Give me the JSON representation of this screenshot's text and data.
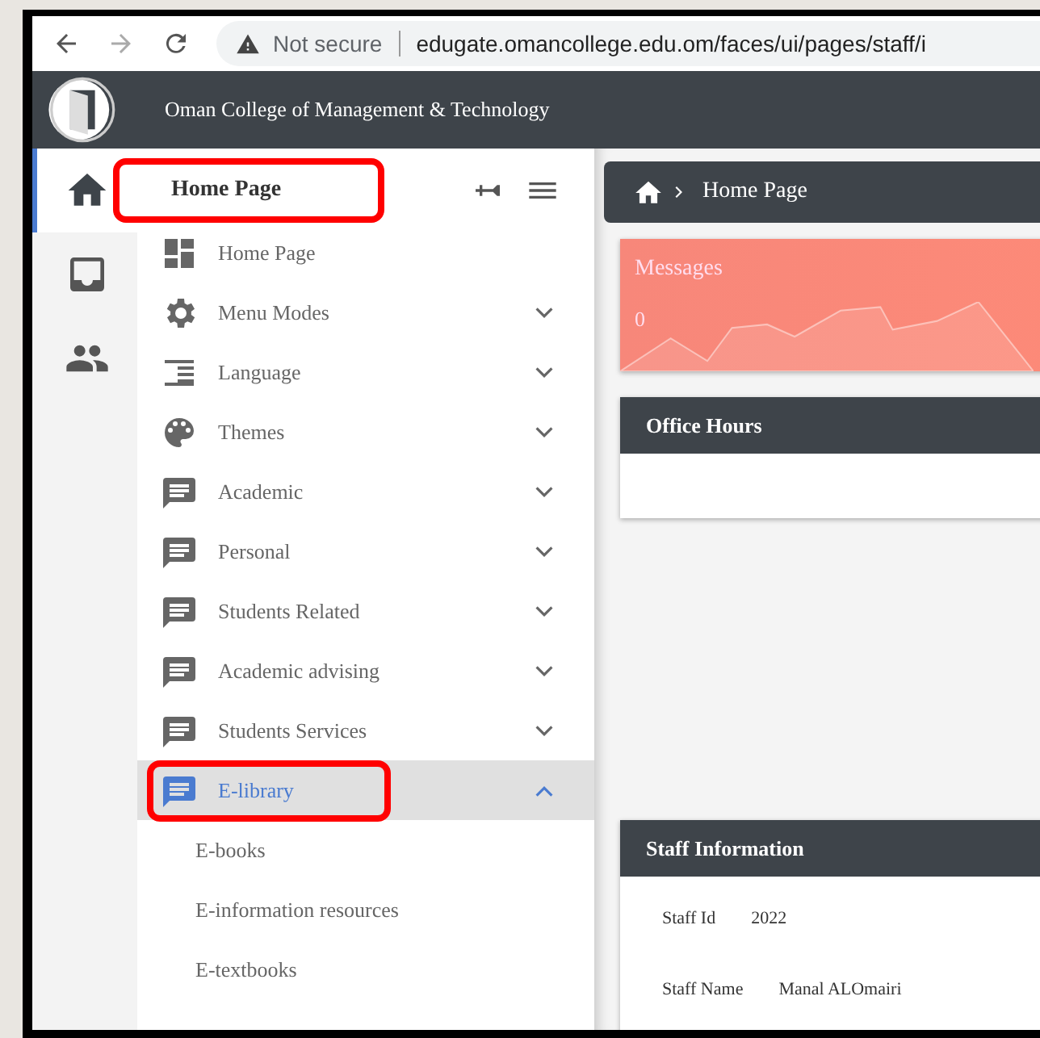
{
  "browser": {
    "security": "Not secure",
    "url": "edugate.omancollege.edu.om/faces/ui/pages/staff/i"
  },
  "header": {
    "title": "Oman College of Management & Technology"
  },
  "rail": [
    {
      "selected": true
    },
    {
      "selected": false
    },
    {
      "selected": false
    }
  ],
  "menu": {
    "title": "Home Page",
    "annotated": true,
    "items": [
      {
        "kind": "link",
        "label": "Home Page",
        "selected": false,
        "annotated": false
      },
      {
        "kind": "group",
        "label": "Menu Modes",
        "expanded": false,
        "selected": false,
        "annotated": false
      },
      {
        "kind": "group",
        "label": "Language",
        "expanded": false,
        "selected": false,
        "annotated": false
      },
      {
        "kind": "group",
        "label": "Themes",
        "expanded": false,
        "selected": false,
        "annotated": false
      },
      {
        "kind": "group",
        "label": "Academic",
        "expanded": false,
        "selected": false,
        "annotated": false
      },
      {
        "kind": "group",
        "label": "Personal",
        "expanded": false,
        "selected": false,
        "annotated": false
      },
      {
        "kind": "group",
        "label": "Students Related",
        "expanded": false,
        "selected": false,
        "annotated": false
      },
      {
        "kind": "group",
        "label": "Academic advising",
        "expanded": false,
        "selected": false,
        "annotated": false
      },
      {
        "kind": "group",
        "label": "Students Services",
        "expanded": false,
        "selected": false,
        "annotated": false
      },
      {
        "kind": "group",
        "label": "E-library",
        "expanded": true,
        "selected": true,
        "annotated": true,
        "children": [
          {
            "label": "E-books"
          },
          {
            "label": "E-information resources"
          },
          {
            "label": "E-textbooks"
          }
        ]
      }
    ]
  },
  "breadcrumb": {
    "label": "Home Page"
  },
  "messages": {
    "title": "Messages",
    "value": "0"
  },
  "office_hours": {
    "title": "Office Hours"
  },
  "staff_information": {
    "title": "Staff Information",
    "fields": [
      {
        "label": "Staff Id",
        "value": "2022"
      },
      {
        "label": "Staff Name",
        "value": "Manal ALOmairi"
      }
    ]
  }
}
